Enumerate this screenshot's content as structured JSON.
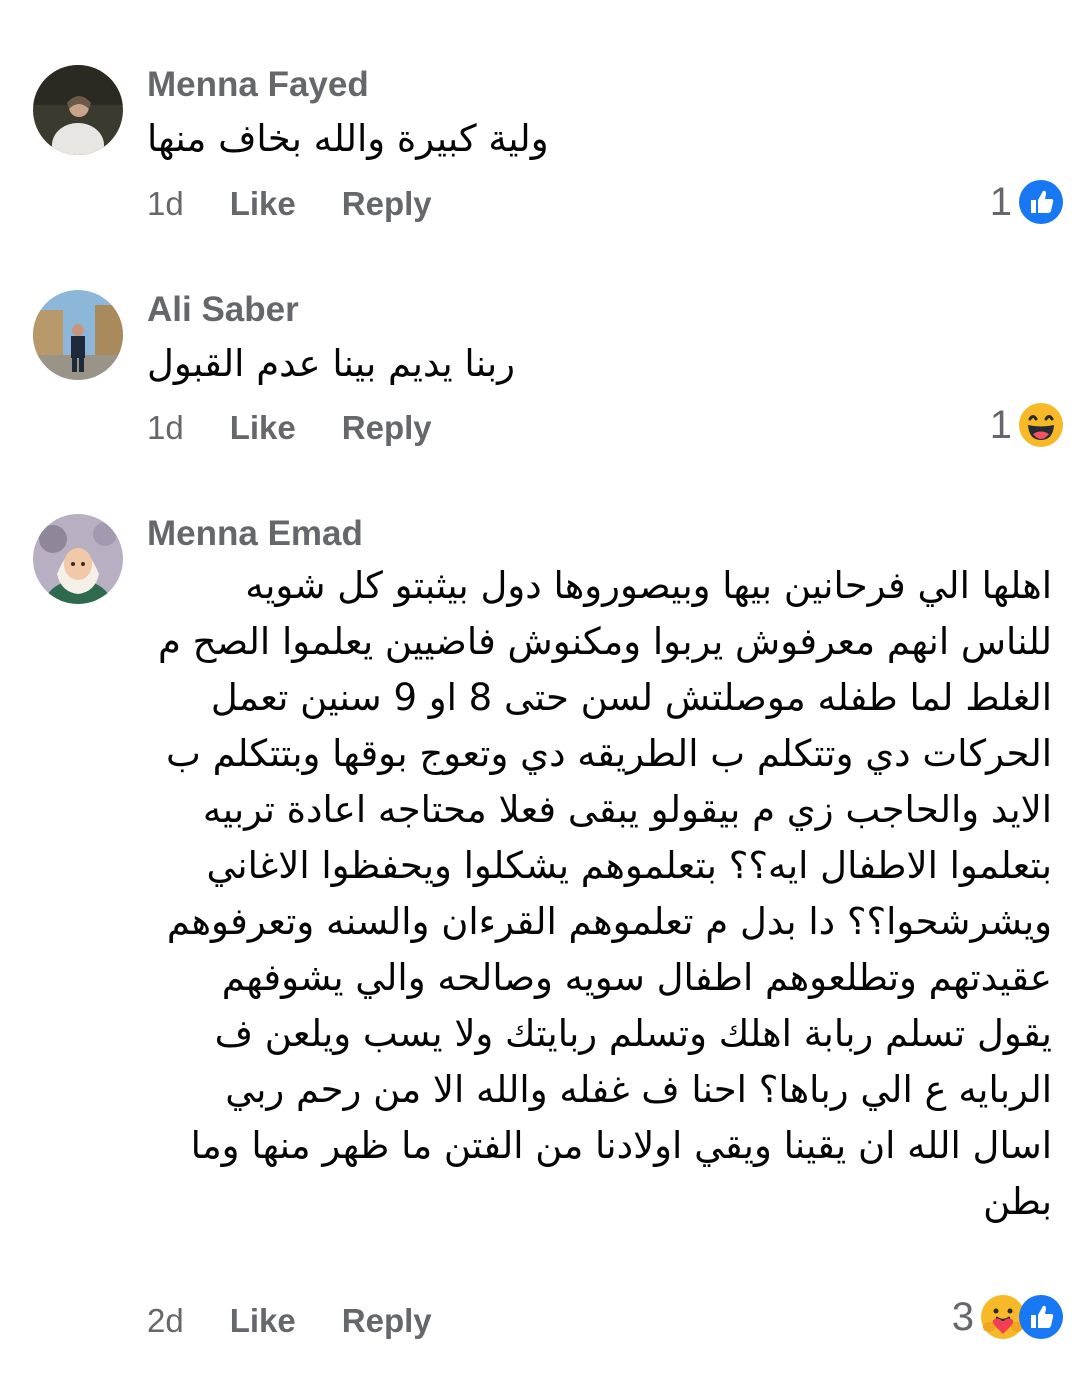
{
  "comments": [
    {
      "author": "Menna Fayed",
      "text": "ولية كبيرة والله بخاف منها",
      "time": "1d",
      "like_label": "Like",
      "reply_label": "Reply",
      "reaction_count": "1",
      "reactions": [
        "like-icon"
      ]
    },
    {
      "author": "Ali Saber",
      "text": "ربنا يديم بينا عدم القبول",
      "time": "1d",
      "like_label": "Like",
      "reply_label": "Reply",
      "reaction_count": "1",
      "reactions": [
        "haha-icon"
      ]
    },
    {
      "author": "Menna Emad",
      "text": "اهلها الي فرحانين بيها وبيصوروها دول بيثبتو كل شويه للناس انهم معرفوش يربوا ومكنوش فاضيين يعلموا الصح م الغلط لما طفله موصلتش لسن حتى 8 او 9 سنين تعمل الحركات دي وتتكلم ب الطريقه دي وتعوج بوقها وبتتكلم ب الايد والحاجب زي م بيقولو يبقى فعلا محتاجه اعادة تربيه\nبتعلموا الاطفال ايه؟؟ بتعلموهم يشكلوا ويحفظوا الاغاني ويشرشحوا؟؟ دا بدل م تعلموهم القرءان والسنه وتعرفوهم عقيدتهم وتطلعوهم اطفال سويه وصالحه والي يشوفهم يقول تسلم ربابة اهلك وتسلم ربايتك ولا يسب ويلعن ف الربايه ع الي رباها؟ احنا ف غفله والله الا من رحم ربي اسال الله ان يقينا ويقي اولادنا من الفتن ما ظهر منها وما بطن",
      "time": "2d",
      "like_label": "Like",
      "reply_label": "Reply",
      "reaction_count": "3",
      "reactions": [
        "care-icon",
        "like-icon"
      ]
    }
  ],
  "colors": {
    "meta_gray": "#65676b",
    "text": "#050505",
    "like_blue": "#1877f2",
    "haha_yellow": "#f7b928"
  }
}
